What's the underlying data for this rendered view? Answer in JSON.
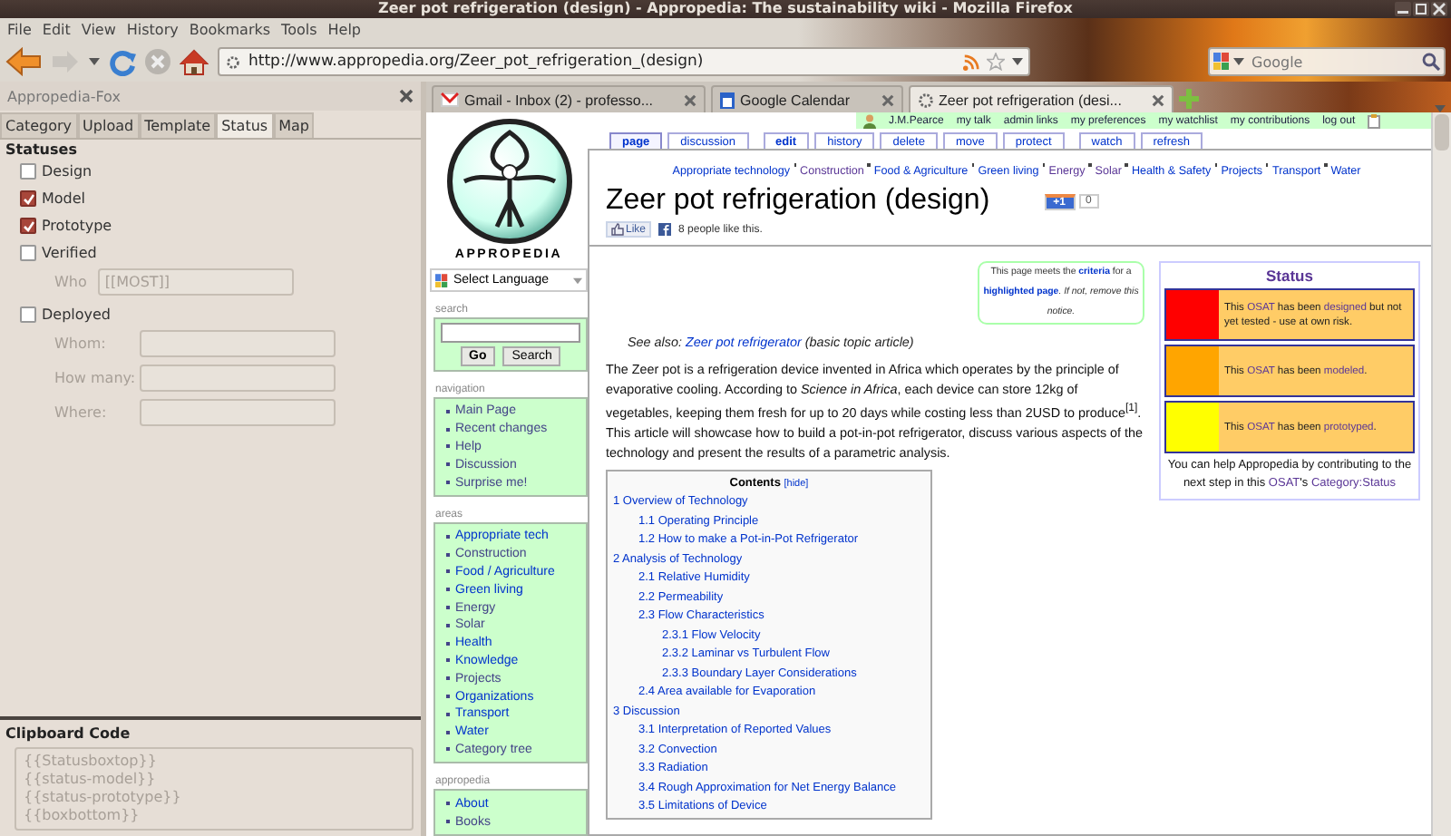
{
  "window": {
    "title": "Zeer pot refrigeration (design) - Appropedia: The sustainability wiki - Mozilla Firefox"
  },
  "menu": [
    "File",
    "Edit",
    "View",
    "History",
    "Bookmarks",
    "Tools",
    "Help"
  ],
  "toolbar": {
    "url": "http://www.appropedia.org/Zeer_pot_refrigeration_(design)",
    "search": {
      "placeholder": "Google"
    }
  },
  "sidebar": {
    "title": "Appropedia-Fox",
    "tabs": [
      {
        "label": "Category",
        "selected": false
      },
      {
        "label": "Upload",
        "selected": false
      },
      {
        "label": "Template",
        "selected": false
      },
      {
        "label": "Status",
        "selected": true
      },
      {
        "label": "Map",
        "selected": false
      }
    ],
    "heading": "Statuses",
    "statuses": [
      {
        "label": "Design",
        "checked": false
      },
      {
        "label": "Model",
        "checked": true
      },
      {
        "label": "Prototype",
        "checked": true
      },
      {
        "label": "Verified",
        "checked": false,
        "fields": [
          {
            "label": "Who",
            "value": "[[MOST]]",
            "disabled": true
          }
        ]
      },
      {
        "label": "Deployed",
        "checked": false,
        "fields": [
          {
            "label": "Whom:",
            "disabled": true
          },
          {
            "label": "How many:",
            "disabled": true
          },
          {
            "label": "Where:",
            "disabled": true
          }
        ]
      }
    ],
    "clipboard": {
      "title": "Clipboard Code",
      "lines": [
        "{{Statusboxtop}}",
        "{{status-model}}",
        "{{status-prototype}}",
        "{{boxbottom}}"
      ]
    }
  },
  "browser_tabs": [
    {
      "title": "Gmail - Inbox (2) - professo...",
      "selected": false
    },
    {
      "title": "Google Calendar",
      "selected": false
    },
    {
      "title": "Zeer pot refrigeration (desi...",
      "selected": true
    }
  ],
  "user_links": [
    "J.M.Pearce",
    "my talk",
    "admin links",
    "my preferences",
    "my watchlist",
    "my contributions",
    "log out"
  ],
  "page_tab_groups": [
    {
      "tabs": [
        {
          "label": "page",
          "selected": true,
          "bold": true
        },
        {
          "label": "discussion",
          "selected": false,
          "bold": false
        }
      ]
    },
    {
      "tabs": [
        {
          "label": "edit",
          "selected": false,
          "bold": true
        },
        {
          "label": "history",
          "selected": false,
          "bold": false
        },
        {
          "label": "delete",
          "selected": false,
          "bold": false
        },
        {
          "label": "move",
          "selected": false,
          "bold": false
        },
        {
          "label": "protect",
          "selected": false,
          "bold": false
        }
      ]
    },
    {
      "tabs": [
        {
          "label": "watch",
          "selected": false,
          "bold": false
        },
        {
          "label": "refresh",
          "selected": false,
          "bold": false
        }
      ]
    }
  ],
  "wiki_sidebar": {
    "logo_text": "APPROPEDIA",
    "language": "Select Language",
    "search": {
      "title": "search",
      "buttons": [
        "Go",
        "Search"
      ]
    },
    "portals": [
      {
        "title": "navigation",
        "items": [
          {
            "label": "Main Page",
            "visited": true
          },
          {
            "label": "Recent changes",
            "visited": true
          },
          {
            "label": "Help",
            "visited": true
          },
          {
            "label": "Discussion",
            "visited": true
          },
          {
            "label": "Surprise me!",
            "visited": true
          }
        ]
      },
      {
        "title": "areas",
        "items": [
          {
            "label": "Appropriate tech",
            "visited": false
          },
          {
            "label": "Construction",
            "visited": true
          },
          {
            "label": "Food / Agriculture",
            "visited": false
          },
          {
            "label": "Green living",
            "visited": false
          },
          {
            "label": "Energy",
            "visited": true
          },
          {
            "label": "Solar",
            "visited": true
          },
          {
            "label": "Health",
            "visited": false
          },
          {
            "label": "Knowledge",
            "visited": false
          },
          {
            "label": "Projects",
            "visited": true
          },
          {
            "label": "Organizations",
            "visited": false
          },
          {
            "label": "Transport",
            "visited": false
          },
          {
            "label": "Water",
            "visited": false
          },
          {
            "label": "Category tree",
            "visited": true
          }
        ]
      },
      {
        "title": "appropedia",
        "items": [
          {
            "label": "About",
            "visited": false
          },
          {
            "label": "Books",
            "visited": true
          }
        ]
      }
    ]
  },
  "article": {
    "categories": [
      {
        "label": "Appropriate technology",
        "visited": false
      },
      {
        "label": "Construction",
        "visited": true
      },
      {
        "label": "Food & Agriculture",
        "visited": false
      },
      {
        "label": "Green living",
        "visited": false
      },
      {
        "label": "Energy",
        "visited": true
      },
      {
        "label": "Solar",
        "visited": true
      },
      {
        "label": "Health & Safety",
        "visited": false
      },
      {
        "label": "Projects",
        "visited": false
      },
      {
        "label": "Transport",
        "visited": false
      },
      {
        "label": "Water",
        "visited": false
      }
    ],
    "title": "Zeer pot refrigeration (design)",
    "plus_one": "+1",
    "plus_count": "0",
    "like": "Like",
    "like_text": "8 people like this.",
    "notice": [
      {
        "text": "This page meets the ",
        "link": false
      },
      {
        "text": "criteria",
        "link": true
      },
      {
        "text": " for a ",
        "link": false
      },
      {
        "text": "highlighted page",
        "link": true
      },
      {
        "text": ". If not, remove this notice.",
        "link": false
      }
    ],
    "see_also": [
      {
        "text": "See also: ",
        "link": false
      },
      {
        "text": "Zeer pot refrigerator",
        "link": true
      },
      {
        "text": " (basic topic article)",
        "link": false
      }
    ],
    "paragraph": "The Zeer pot is a refrigeration device invented in Africa which operates by the principle of evaporative cooling. According to *Science in Africa*, each device can store 12kg of vegetables, keeping them fresh for up to 20 days while costing less than 2USD to produce$^{[1]}$. This article will showcase how to build a pot-in-pot refrigerator, discuss various aspects of the technology and present the results of a parametric analysis.",
    "contents": {
      "title": "Contents",
      "toggle": "[hide]",
      "items": [
        {
          "label": "1 Overview of Technology",
          "children": [
            {
              "label": "1.1 Operating Principle"
            },
            {
              "label": "1.2 How to make a Pot-in-Pot Refrigerator"
            }
          ]
        },
        {
          "label": "2 Analysis of Technology",
          "children": [
            {
              "label": "2.1 Relative Humidity"
            },
            {
              "label": "2.2 Permeability"
            },
            {
              "label": "2.3 Flow Characteristics",
              "children": [
                {
                  "label": "2.3.1 Flow Velocity"
                },
                {
                  "label": "2.3.2 Laminar vs Turbulent Flow"
                },
                {
                  "label": "2.3.3 Boundary Layer Considerations"
                }
              ]
            },
            {
              "label": "2.4 Area available for Evaporation"
            }
          ]
        },
        {
          "label": "3 Discussion",
          "children": [
            {
              "label": "3.1 Interpretation of Reported Values"
            },
            {
              "label": "3.2 Convection"
            },
            {
              "label": "3.3 Radiation"
            },
            {
              "label": "3.4 Rough Approximation for Net Energy Balance"
            },
            {
              "label": "3.5 Limitations of Device"
            }
          ]
        }
      ]
    },
    "status_box": {
      "title": "Status",
      "rows": [
        {
          "color": "#ff0000",
          "text": [
            {
              "text": "This ",
              "link": false
            },
            {
              "text": "OSAT",
              "link": true
            },
            {
              "text": " has been ",
              "link": false
            },
            {
              "text": "designed",
              "link": true
            },
            {
              "text": " but not yet tested - use at own risk.",
              "link": false
            }
          ]
        },
        {
          "color": "#ffa500",
          "text": [
            {
              "text": "This ",
              "link": false
            },
            {
              "text": "OSAT",
              "link": true
            },
            {
              "text": " has been ",
              "link": false
            },
            {
              "text": "modeled",
              "link": true
            },
            {
              "text": ".",
              "link": false
            }
          ]
        },
        {
          "color": "#ffff00",
          "text": [
            {
              "text": "This ",
              "link": false
            },
            {
              "text": "OSAT",
              "link": true
            },
            {
              "text": " has been ",
              "link": false
            },
            {
              "text": "prototyped",
              "link": true
            },
            {
              "text": ".",
              "link": false
            }
          ]
        }
      ],
      "footer": [
        {
          "text": "You can help Appropedia by contributing to the next step in this ",
          "link": false
        },
        {
          "text": "OSAT",
          "link": true
        },
        {
          "text": "'s ",
          "link": false
        },
        {
          "text": "Category:Status",
          "link": true
        }
      ]
    }
  }
}
